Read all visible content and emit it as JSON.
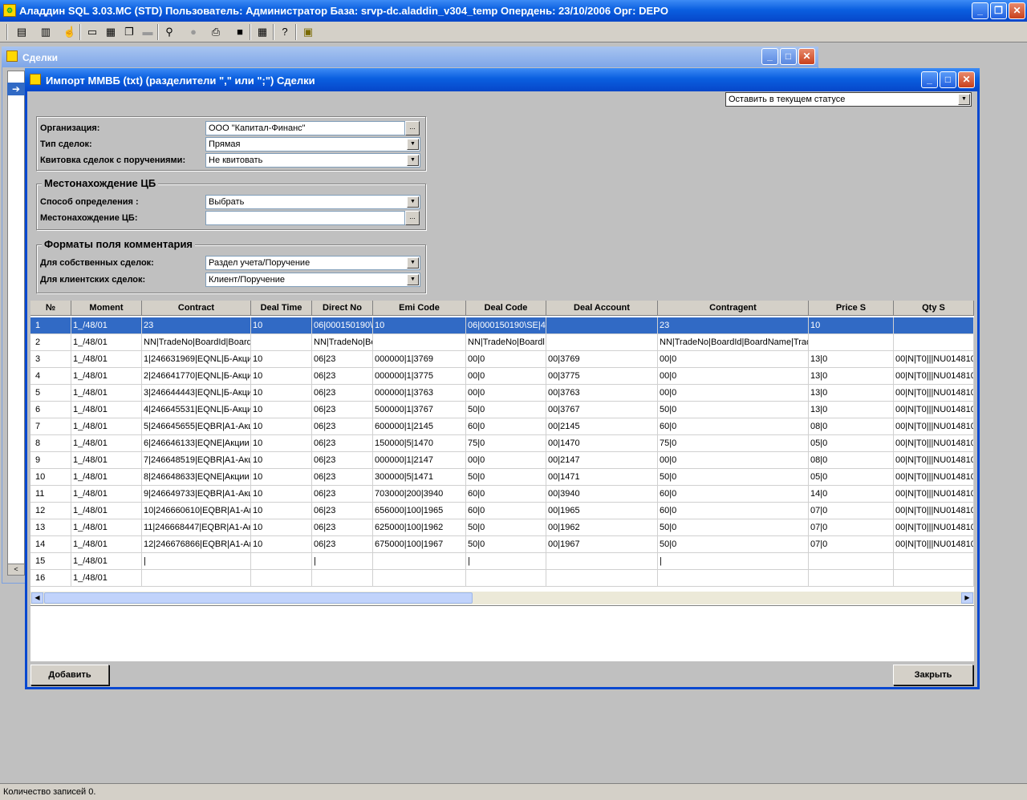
{
  "app": {
    "title": "Аладдин SQL 3.03.MC (STD)  Пользователь: Администратор База: srvp-dc.aladdin_v304_temp Опердень: 23/10/2006 Орг: DEPO",
    "status": "Количество записей 0."
  },
  "toolbar": {
    "icons": [
      "list-icon",
      "database-icon",
      "hand-icon",
      "window-icon",
      "tile-icon",
      "cascade-icon",
      "minimize-all-icon",
      "binoculars-icon",
      "stop-icon",
      "print-icon",
      "save-icon",
      "calendar-icon",
      "help-icon",
      "module-icon"
    ],
    "glyphs": [
      "▤",
      "▥",
      "☝",
      "▭",
      "▦",
      "❐",
      "▬",
      "⚲",
      "●",
      "⎙",
      "■",
      "▦",
      "?",
      "▣"
    ]
  },
  "back_window": {
    "title": "Сделки",
    "arrow": "➔",
    "scroll_left": "<"
  },
  "dialog": {
    "title": "Импорт ММВБ (txt) (разделители \",\" или \";\") Сделки",
    "status_select": "Оставить в текущем статусе",
    "org_label": "Организация:",
    "org_value": "ООО \"Капитал-Финанс\"",
    "deal_type_label": "Тип сделок:",
    "deal_type_value": "Прямая",
    "kvit_label": "Квитовка сделок с поручениями:",
    "kvit_value": "Не квитовать",
    "cb_group_title": "Местонахождение ЦБ",
    "method_label": "Способ определения :",
    "method_value": "Выбрать",
    "location_label": "Местонахождение ЦБ:",
    "location_value": "",
    "comment_group_title": "Форматы поля комментария",
    "own_label": "Для собственных сделок:",
    "own_value": "Раздел учета/Поручение",
    "client_label": "Для клиентских сделок:",
    "client_value": "Клиент/Поручение",
    "add_button": "Добавить",
    "close_button": "Закрыть",
    "ellipsis": "...",
    "dropdown_glyph": "▼"
  },
  "grid": {
    "columns": [
      "№",
      "Moment",
      "Contract",
      "Deal Time",
      "Direct No",
      "Emi Code",
      "Deal Code",
      "Deal Account",
      "Contragent",
      "Price S",
      "Qty S"
    ],
    "rows": [
      [
        "1",
        "1_/48/01",
        "23",
        "10",
        "06|000150190\\",
        "10",
        "06|000150190\\SE|4",
        "",
        "23",
        "10",
        ""
      ],
      [
        "2",
        "1_/48/01",
        "NN|TradeNo|BoardId|Boardl",
        "",
        "NN|TradeNo|Bo",
        "",
        "NN|TradeNo|Boardl",
        "",
        "NN|TradeNo|BoardId|BoardName|Trad",
        "",
        ""
      ],
      [
        "3",
        "1_/48/01",
        "1|246631969|EQNL|Б-Акци",
        "10",
        "06|23",
        "000000|1|3769",
        "00|0",
        "00|3769",
        "00|0",
        "13|0",
        "00|N|T0|||NU014810"
      ],
      [
        "4",
        "1_/48/01",
        "2|246641770|EQNL|Б-Акци",
        "10",
        "06|23",
        "000000|1|3775",
        "00|0",
        "00|3775",
        "00|0",
        "13|0",
        "00|N|T0|||NU014810"
      ],
      [
        "5",
        "1_/48/01",
        "3|246644443|EQNL|Б-Акци",
        "10",
        "06|23",
        "000000|1|3763",
        "00|0",
        "00|3763",
        "00|0",
        "13|0",
        "00|N|T0|||NU014810"
      ],
      [
        "6",
        "1_/48/01",
        "4|246645531|EQNL|Б-Акци",
        "10",
        "06|23",
        "500000|1|3767",
        "50|0",
        "00|3767",
        "50|0",
        "13|0",
        "00|N|T0|||NU014810"
      ],
      [
        "7",
        "1_/48/01",
        "5|246645655|EQBR|A1-Акц",
        "10",
        "06|23",
        "600000|1|2145",
        "60|0",
        "00|2145",
        "60|0",
        "08|0",
        "00|N|T0|||NU014810"
      ],
      [
        "8",
        "1_/48/01",
        "6|246646133|EQNE|Акции",
        "10",
        "06|23",
        "150000|5|1470",
        "75|0",
        "00|1470",
        "75|0",
        "05|0",
        "00|N|T0|||NU014810"
      ],
      [
        "9",
        "1_/48/01",
        "7|246648519|EQBR|A1-Акц",
        "10",
        "06|23",
        "000000|1|2147",
        "00|0",
        "00|2147",
        "00|0",
        "08|0",
        "00|N|T0|||NU014810"
      ],
      [
        "10",
        "1_/48/01",
        "8|246648633|EQNE|Акции",
        "10",
        "06|23",
        "300000|5|1471",
        "50|0",
        "00|1471",
        "50|0",
        "05|0",
        "00|N|T0|||NU014810"
      ],
      [
        "11",
        "1_/48/01",
        "9|246649733|EQBR|A1-Акц",
        "10",
        "06|23",
        "703000|200|3940",
        "60|0",
        "00|3940",
        "60|0",
        "14|0",
        "00|N|T0|||NU014810"
      ],
      [
        "12",
        "1_/48/01",
        "10|246660610|EQBR|A1-Ак",
        "10",
        "06|23",
        "656000|100|1965",
        "60|0",
        "00|1965",
        "60|0",
        "07|0",
        "00|N|T0|||NU014810"
      ],
      [
        "13",
        "1_/48/01",
        "11|246668447|EQBR|A1-Ак",
        "10",
        "06|23",
        "625000|100|1962",
        "50|0",
        "00|1962",
        "50|0",
        "07|0",
        "00|N|T0|||NU014810"
      ],
      [
        "14",
        "1_/48/01",
        "12|246676866|EQBR|A1-Ак",
        "10",
        "06|23",
        "675000|100|1967",
        "50|0",
        "00|1967",
        "50|0",
        "07|0",
        "00|N|T0|||NU014810"
      ],
      [
        "15",
        "1_/48/01",
        "|",
        "",
        "|",
        "",
        "|",
        "",
        "|",
        "",
        ""
      ],
      [
        "16",
        "1_/48/01",
        "",
        "",
        "",
        "",
        "",
        "",
        "",
        "",
        ""
      ]
    ]
  }
}
